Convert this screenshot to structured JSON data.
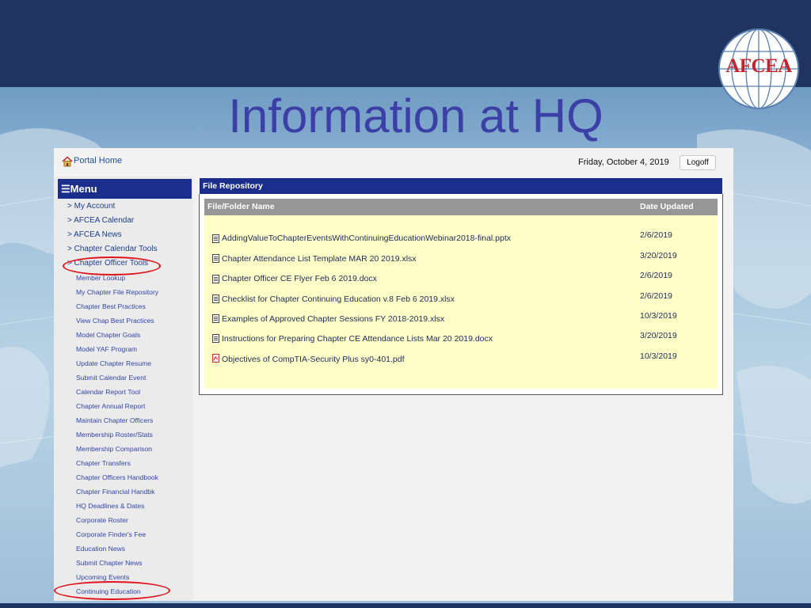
{
  "slide": {
    "title": "Information at HQ",
    "logo_text": "AFCEA"
  },
  "portal": {
    "home_label": "Portal Home",
    "date": "Friday, October 4, 2019",
    "logoff_label": "Logoff"
  },
  "menu": {
    "header": "Menu",
    "top_items": [
      "> My Account",
      "> AFCEA Calendar",
      "> AFCEA News",
      "> Chapter Calendar Tools",
      "> Chapter Officer Tools"
    ],
    "sub_items": [
      "Member Lookup",
      "My Chapter File Repository",
      "Chapter Best Practices",
      "View Chap Best Practices",
      "Model Chapter Goals",
      "Model YAF Program",
      "Update Chapter Resume",
      "Submit Calendar Event",
      "Calendar Report Tool",
      "Chapter Annual Report",
      "Maintain Chapter Officers",
      "Membership Roster/Stats",
      "Membership Comparison",
      "Chapter Transfers",
      "Chapter Officers Handbook",
      "Chapter Financial Handbk",
      "HQ Deadlines & Dates",
      "Corporate Roster",
      "Corporate Finder's Fee",
      "Education News",
      "Submit Chapter News",
      "Upcoming Events",
      "Continuing Education"
    ]
  },
  "repository": {
    "header": "File Repository",
    "col_name": "File/Folder Name",
    "col_date": "Date Updated",
    "files": [
      {
        "name": "AddingValueToChapterEventsWithContinuingEducationWebinar2018-final.pptx",
        "date": "2/6/2019",
        "icon": "document-icon"
      },
      {
        "name": "Chapter Attendance List Template MAR 20 2019.xlsx",
        "date": "3/20/2019",
        "icon": "document-icon"
      },
      {
        "name": "Chapter Officer CE Flyer Feb 6 2019.docx",
        "date": "2/6/2019",
        "icon": "document-icon"
      },
      {
        "name": "Checklist for Chapter Continuing Education v.8 Feb 6 2019.xlsx",
        "date": "2/6/2019",
        "icon": "document-icon"
      },
      {
        "name": "Examples of Approved Chapter Sessions FY 2018-2019.xlsx",
        "date": "10/3/2019",
        "icon": "document-icon"
      },
      {
        "name": "Instructions for Preparing Chapter CE Attendance Lists Mar 20 2019.docx",
        "date": "3/20/2019",
        "icon": "document-icon"
      },
      {
        "name": "Objectives of CompTIA-Security Plus sy0-401.pdf",
        "date": "10/3/2019",
        "icon": "pdf-icon"
      }
    ]
  },
  "colors": {
    "navy": "#1f3461",
    "menu_blue": "#1b2e8c",
    "title_purple": "#3b3fa6",
    "highlight_red": "#e0141e",
    "panel_yellow": "#ffffc8"
  }
}
